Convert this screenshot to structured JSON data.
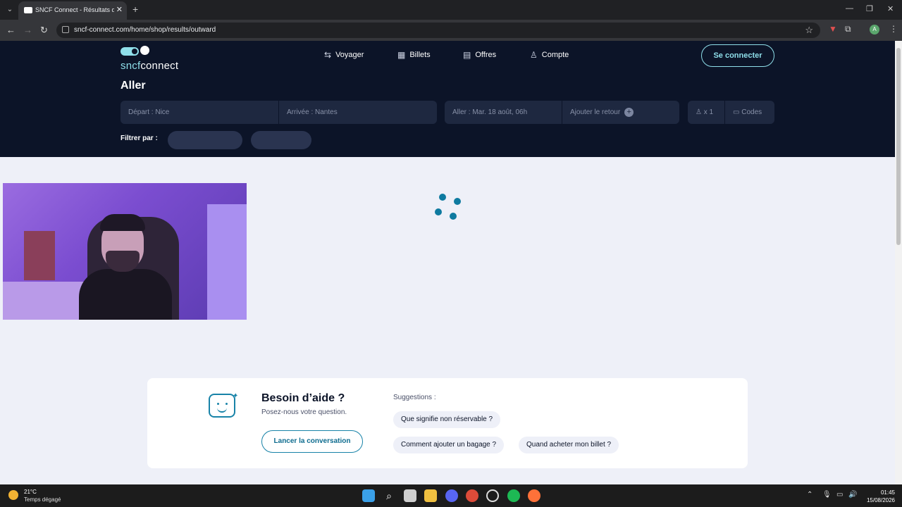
{
  "browser": {
    "tab_title": "SNCF Connect - Résultats d'itin",
    "url": "sncf-connect.com/home/shop/results/outward",
    "profile_initial": "A"
  },
  "site": {
    "logo_sncf": "sncf",
    "logo_connect": "connect",
    "nav": [
      {
        "label": "Voyager",
        "icon": "route-icon"
      },
      {
        "label": "Billets",
        "icon": "qr-code-icon"
      },
      {
        "label": "Offres",
        "icon": "book-icon"
      },
      {
        "label": "Compte",
        "icon": "user-icon"
      }
    ],
    "login_label": "Se connecter"
  },
  "search": {
    "title": "Aller",
    "departure": "Départ : Nice",
    "arrival": "Arrivée : Nantes",
    "outward_date": "Aller : Mar. 18 août, 06h",
    "add_return": "Ajouter le retour",
    "passengers": "x 1",
    "codes": "Codes",
    "filter_label": "Filtrer par :"
  },
  "help": {
    "title": "Besoin d’aide ?",
    "subtitle": "Posez-nous votre question.",
    "chat_button": "Lancer la conversation",
    "suggestions_label": "Suggestions :",
    "suggestions": [
      "Que signifie non réservable ?",
      "Comment ajouter un bagage ?",
      "Quand acheter mon billet ?"
    ]
  },
  "taskbar": {
    "temperature": "21°C",
    "weather": "Temps dégagé",
    "time": "01:45",
    "date": "15/08/2026"
  },
  "colors": {
    "hero_bg": "#0c1428",
    "accent": "#8fdfea",
    "spinner": "#0e7aa0"
  }
}
